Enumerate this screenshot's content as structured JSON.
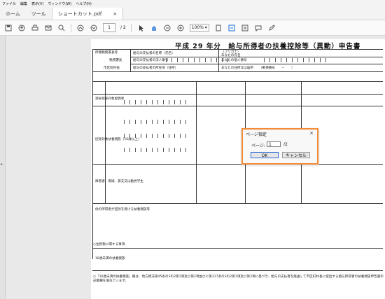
{
  "menubar": {
    "items": [
      "ファイル",
      "編集",
      "表示(V)",
      "ウィンドウ(W)",
      "ヘルプ(H)"
    ]
  },
  "tabs": {
    "home": "ホーム",
    "tools": "ツール",
    "file": "ショートカット.pdf",
    "close": "×"
  },
  "toolbar": {
    "page_current": "1",
    "page_total": "/ 2",
    "zoom": "100%"
  },
  "document": {
    "title": "平成 29 年分　給与所得者の扶養控除等（異動）申告書",
    "labels": {
      "office": "所轄税務署長等",
      "tax_office": "税務署長",
      "city": "市区町村長",
      "payer_name": "給与の支払者の名称（氏名）",
      "payer_number": "給与の支払者の法人番号",
      "payer_address": "給与の支払者の所在地（住所）",
      "furigana": "（フリガナ）",
      "your_name": "あなたの氏名",
      "your_number": "あなたの個人番号",
      "your_address": "あなたの住所又は居所",
      "postal": "（郵便番号　　－　　）",
      "spouse": "源泉控除対象配偶者",
      "dependents": "控除対象扶養親族（16歳以上）",
      "disabled": "障害者、寡婦、寡夫又は勤労学生",
      "other_income": "他の所得者が控除を受ける扶養親族等",
      "resident": "○住民税に関する事項",
      "under16": "16歳未満の扶養親族",
      "note": "○「16歳未満の扶養親族」欄は、地方税法第45条の3の2第1項及び第2項並びに第317条の3の2第1項及び第2項に基づき、給与の支払者を経由して市区町村長に提出する給与所得者の扶養親族申告書の記載欄を兼ねています。"
    }
  },
  "dialog": {
    "title": "ページ指定",
    "close": "×",
    "page_label": "ページ:",
    "page_value": "1",
    "total": "/2",
    "ok": "OK",
    "cancel": "キャンセル"
  }
}
